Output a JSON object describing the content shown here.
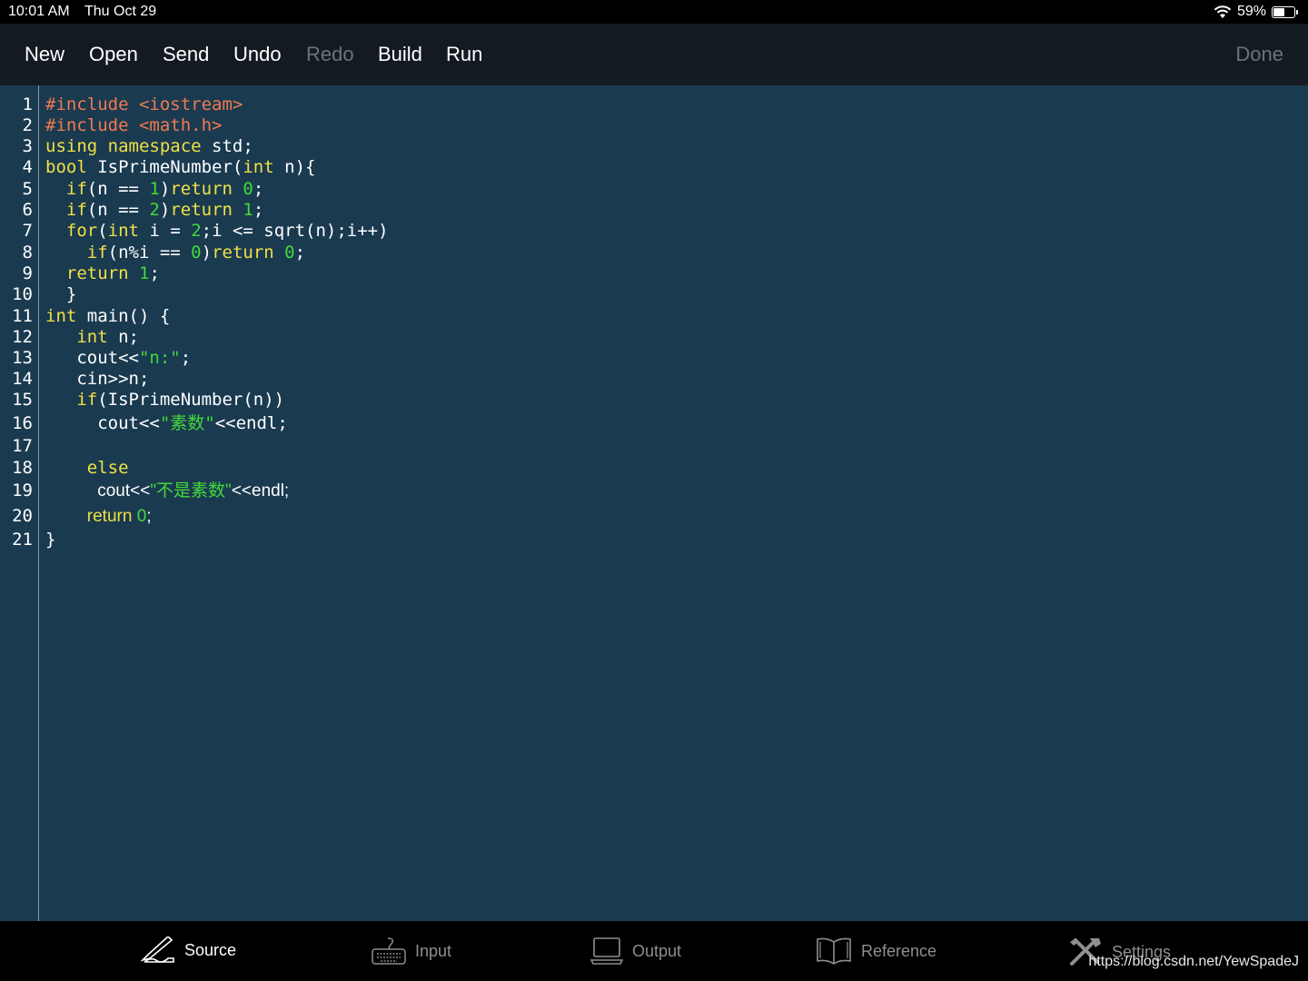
{
  "status": {
    "time": "10:01 AM",
    "date": "Thu Oct 29",
    "battery_pct_label": "59%",
    "battery_level": 0.59
  },
  "toolbar": {
    "new": "New",
    "open": "Open",
    "send": "Send",
    "undo": "Undo",
    "redo": "Redo",
    "build": "Build",
    "run": "Run",
    "done": "Done"
  },
  "editor": {
    "line_numbers": [
      "1",
      "2",
      "3",
      "4",
      "5",
      "6",
      "7",
      "8",
      "9",
      "10",
      "11",
      "12",
      "13",
      "14",
      "15",
      "16",
      "17",
      "18",
      "19",
      "20",
      "21"
    ],
    "lines": [
      [
        [
          "pp",
          "#include <iostream>"
        ]
      ],
      [
        [
          "pp",
          "#include <math.h>"
        ]
      ],
      [
        [
          "kw",
          "using namespace"
        ],
        [
          "pl",
          " std;"
        ]
      ],
      [
        [
          "kw",
          "bool"
        ],
        [
          "pl",
          " IsPrimeNumber("
        ],
        [
          "kw",
          "int"
        ],
        [
          "pl",
          " n){"
        ]
      ],
      [
        [
          "pl",
          "  "
        ],
        [
          "kw",
          "if"
        ],
        [
          "pl",
          "(n == "
        ],
        [
          "num",
          "1"
        ],
        [
          "pl",
          ")"
        ],
        [
          "kw",
          "return"
        ],
        [
          "pl",
          " "
        ],
        [
          "num",
          "0"
        ],
        [
          "pl",
          ";"
        ]
      ],
      [
        [
          "pl",
          "  "
        ],
        [
          "kw",
          "if"
        ],
        [
          "pl",
          "(n == "
        ],
        [
          "num",
          "2"
        ],
        [
          "pl",
          ")"
        ],
        [
          "kw",
          "return"
        ],
        [
          "pl",
          " "
        ],
        [
          "num",
          "1"
        ],
        [
          "pl",
          ";"
        ]
      ],
      [
        [
          "pl",
          "  "
        ],
        [
          "kw",
          "for"
        ],
        [
          "pl",
          "("
        ],
        [
          "kw",
          "int"
        ],
        [
          "pl",
          " i = "
        ],
        [
          "num",
          "2"
        ],
        [
          "pl",
          ";i <= sqrt(n);i++)"
        ]
      ],
      [
        [
          "pl",
          "    "
        ],
        [
          "kw",
          "if"
        ],
        [
          "pl",
          "(n%i == "
        ],
        [
          "num",
          "0"
        ],
        [
          "pl",
          ")"
        ],
        [
          "kw",
          "return"
        ],
        [
          "pl",
          " "
        ],
        [
          "num",
          "0"
        ],
        [
          "pl",
          ";"
        ]
      ],
      [
        [
          "pl",
          "  "
        ],
        [
          "kw",
          "return"
        ],
        [
          "pl",
          " "
        ],
        [
          "num",
          "1"
        ],
        [
          "pl",
          ";"
        ]
      ],
      [
        [
          "pl",
          "  }"
        ]
      ],
      [
        [
          "kw",
          "int"
        ],
        [
          "pl",
          " main() {"
        ]
      ],
      [
        [
          "pl",
          "   "
        ],
        [
          "kw",
          "int"
        ],
        [
          "pl",
          " n;"
        ]
      ],
      [
        [
          "pl",
          "   cout<<"
        ],
        [
          "str",
          "\"n:\""
        ],
        [
          "pl",
          ";"
        ]
      ],
      [
        [
          "pl",
          "   cin>>n;"
        ]
      ],
      [
        [
          "pl",
          "   "
        ],
        [
          "kw",
          "if"
        ],
        [
          "pl",
          "(IsPrimeNumber(n))"
        ]
      ],
      [
        [
          "pl",
          "     cout<<"
        ],
        [
          "str",
          "\"素数\""
        ],
        [
          "pl",
          "<<endl;"
        ]
      ],
      [
        [
          "pl",
          ""
        ]
      ],
      [
        [
          "pl",
          "    "
        ],
        [
          "kw",
          "else"
        ]
      ],
      [
        [
          "pl",
          "     "
        ],
        [
          "prop pl",
          "cout<<"
        ],
        [
          "prop str",
          "\"不是素数\""
        ],
        [
          "prop pl",
          "<<endl;"
        ]
      ],
      [
        [
          "pl",
          "    "
        ],
        [
          "prop kw",
          "return"
        ],
        [
          "prop pl",
          " "
        ],
        [
          "prop num",
          "0"
        ],
        [
          "prop pl",
          ";"
        ]
      ],
      [
        [
          "pl",
          "}"
        ]
      ]
    ]
  },
  "tabs": {
    "source": "Source",
    "input": "Input",
    "output": "Output",
    "reference": "Reference",
    "settings": "Settings"
  },
  "watermark": "https://blog.csdn.net/YewSpadeJ",
  "colors": {
    "editor_bg": "#1a3a50",
    "preprocessor": "#f07a4f",
    "keyword": "#f0e046",
    "literal": "#42d83a"
  }
}
